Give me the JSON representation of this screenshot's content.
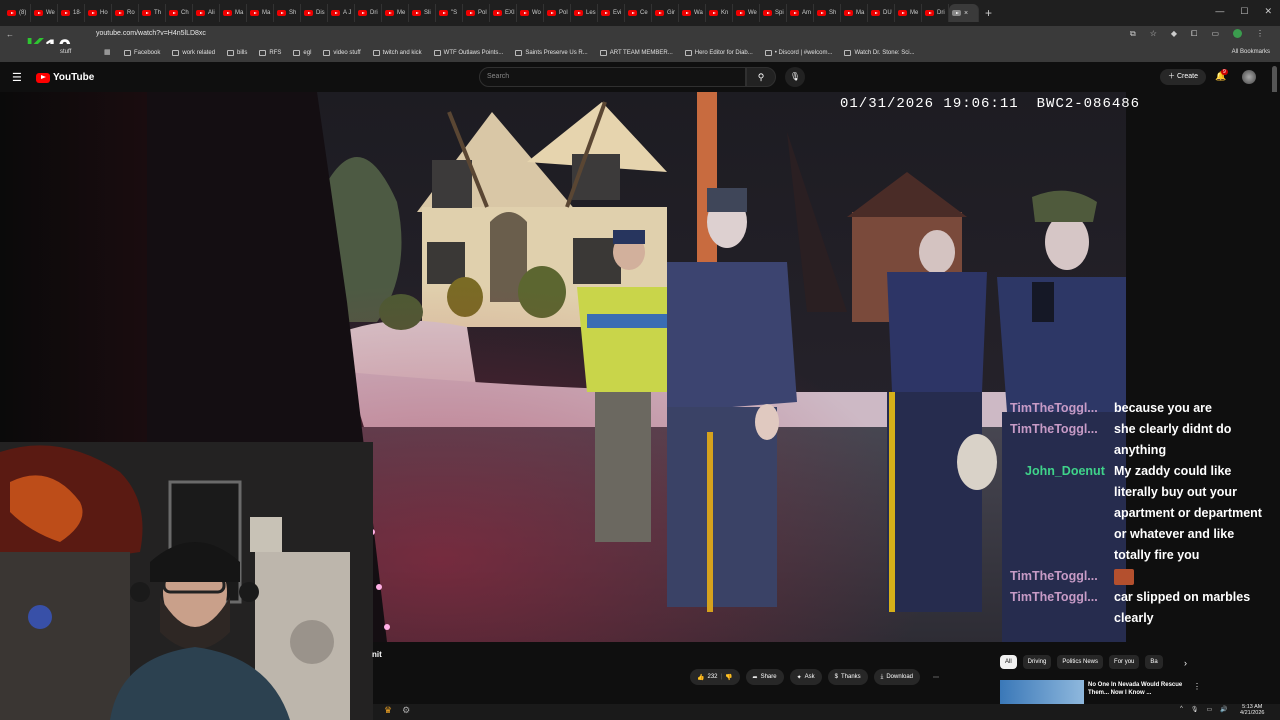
{
  "browser": {
    "tabs": [
      "(8)",
      "We",
      "18·",
      "Ho",
      "Ro",
      "Th",
      "Ch",
      "Ali",
      "Ma",
      "Ma",
      "Sh",
      "Dis",
      "A J",
      "Dri",
      "Me",
      "Sli",
      "\"S",
      "Pol",
      "EXI",
      "Wo",
      "Pol",
      "Les",
      "Evi",
      "Ce",
      "Gir",
      "Wa",
      "Kn",
      "We",
      "Spi",
      "Am",
      "Sh",
      "Ma",
      "DU",
      "Me",
      "Dri"
    ],
    "active_tab_close": "×",
    "new_tab": "+",
    "url": "youtube.com/watch?v=H4n5lLD8xc",
    "overlay_logo_letter": "K",
    "overlay_logo_number": "10",
    "bookmarks": [
      "Facebook",
      "work related",
      "bills",
      "RFS",
      "egl",
      "video stuff",
      "twitch and kick",
      "WTF Outlaws Points...",
      "Saints Preserve Us R...",
      "ART TEAM MEMBER...",
      "Hero Editor for Diab...",
      "• Discord | #welcom...",
      "Watch Dr. Stone: Sci..."
    ],
    "all_bookmarks": "All Bookmarks",
    "folder_stub": "stuff"
  },
  "youtube": {
    "logo_text": "YouTube",
    "search_placeholder": "Search",
    "create_label": "Create",
    "notif_count": "9"
  },
  "video": {
    "timestamp": "01/31/2026 19:06:11",
    "camera_id": "BWC2-086486"
  },
  "chat": [
    {
      "name": "TimTheToggl...",
      "color": "pink",
      "lines": [
        "because you are"
      ]
    },
    {
      "name": "TimTheToggl...",
      "color": "pink",
      "lines": [
        "she clearly didnt do",
        "anything"
      ]
    },
    {
      "name": "John_Doenut",
      "color": "green",
      "lines": [
        "My zaddy could like",
        "literally buy out your",
        "apartment or department",
        "or whatever and like",
        "totally fire you"
      ]
    },
    {
      "name": "TimTheToggl...",
      "color": "pink",
      "lines": [
        ""
      ]
    },
    {
      "name": "TimTheToggl...",
      "color": "pink",
      "lines": [
        "car slipped on marbles",
        "clearly"
      ]
    }
  ],
  "below_video": {
    "title_fragment": "nit",
    "like_count": "232",
    "share": "Share",
    "ask": "Ask",
    "thanks": "Thanks",
    "download": "Download"
  },
  "chips": [
    "All",
    "Driving",
    "Politics News",
    "For you",
    "Ba"
  ],
  "recommendation": {
    "title": "No One In Nevada Would Rescue Them... Now I Know ..."
  },
  "clock": {
    "time": "5:13 AM",
    "date": "4/21/2026"
  }
}
